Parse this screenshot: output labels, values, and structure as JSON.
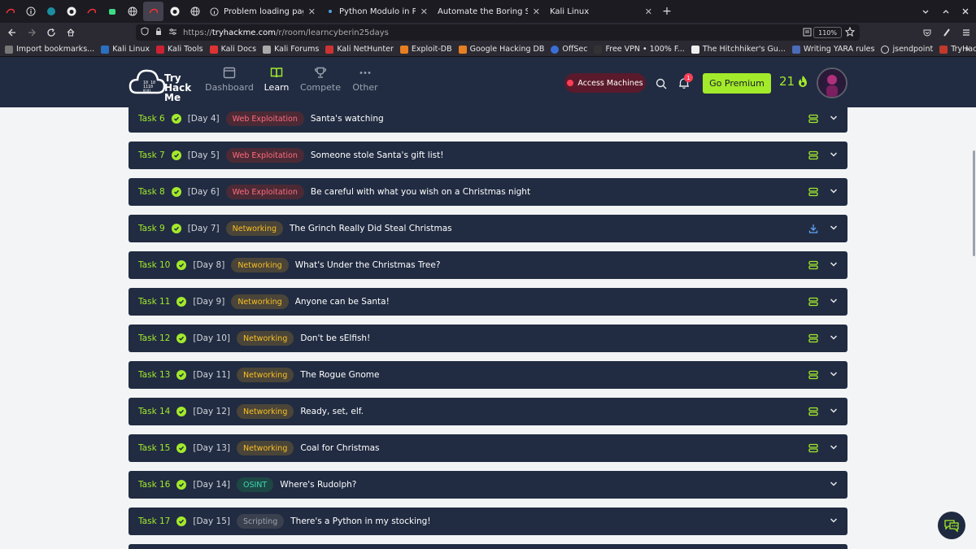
{
  "browser": {
    "tabs": [
      {
        "title": "Problem loading page"
      },
      {
        "title": "Python Modulo in Practic"
      },
      {
        "title": "Automate the Boring Stuff w"
      },
      {
        "title": "Kali Linux"
      }
    ],
    "tab_close": "✕",
    "new_tab": "+",
    "url_scheme": "https://",
    "url_host": "tryhackme.com",
    "url_path": "/r/room/learncyberin25days",
    "zoom": "110%",
    "bookmarks": [
      "Import bookmarks...",
      "Kali Linux",
      "Kali Tools",
      "Kali Docs",
      "Kali Forums",
      "Kali NetHunter",
      "Exploit-DB",
      "Google Hacking DB",
      "OffSec",
      "Free VPN • 100% F...",
      "The Hitchhiker's Gu...",
      "Writing YARA rules",
      "jsendpoint",
      "TryHackMe | Linux ..."
    ]
  },
  "header": {
    "logo_line1": "Try",
    "logo_line2": "Hack",
    "logo_line3": "Me",
    "nav": [
      {
        "label": "Dashboard"
      },
      {
        "label": "Learn"
      },
      {
        "label": "Compete"
      },
      {
        "label": "Other"
      }
    ],
    "access_label": "Access Machines",
    "notification_count": "1",
    "premium_label": "Go Premium",
    "streak": "21"
  },
  "tasks": [
    {
      "num": "Task 6",
      "day": "[Day 4]",
      "tag": "Web Exploitation",
      "title": "Santa's watching"
    },
    {
      "num": "Task 7",
      "day": "[Day 5]",
      "tag": "Web Exploitation",
      "title": "Someone stole Santa's gift list!"
    },
    {
      "num": "Task 8",
      "day": "[Day 6]",
      "tag": "Web Exploitation",
      "title": "Be careful with what you wish on a Christmas night"
    },
    {
      "num": "Task 9",
      "day": "[Day 7]",
      "tag": "Networking",
      "title": "The Grinch Really Did Steal Christmas"
    },
    {
      "num": "Task 10",
      "day": "[Day 8]",
      "tag": "Networking",
      "title": "What's Under the Christmas Tree?"
    },
    {
      "num": "Task 11",
      "day": "[Day 9]",
      "tag": "Networking",
      "title": "Anyone can be Santa!"
    },
    {
      "num": "Task 12",
      "day": "[Day 10]",
      "tag": "Networking",
      "title": "Don't be sElfish!"
    },
    {
      "num": "Task 13",
      "day": "[Day 11]",
      "tag": "Networking",
      "title": "The Rogue Gnome"
    },
    {
      "num": "Task 14",
      "day": "[Day 12]",
      "tag": "Networking",
      "title": "Ready, set, elf."
    },
    {
      "num": "Task 15",
      "day": "[Day 13]",
      "tag": "Networking",
      "title": "Coal for Christmas"
    },
    {
      "num": "Task 16",
      "day": "[Day 14]",
      "tag": "OSINT",
      "title": "Where's Rudolph?"
    },
    {
      "num": "Task 17",
      "day": "[Day 15]",
      "tag": "Scripting",
      "title": "There's a Python in my stocking!"
    }
  ],
  "colors": {
    "accent": "#a3ea2a",
    "panel": "#212c42",
    "alert": "#ff3e57"
  }
}
